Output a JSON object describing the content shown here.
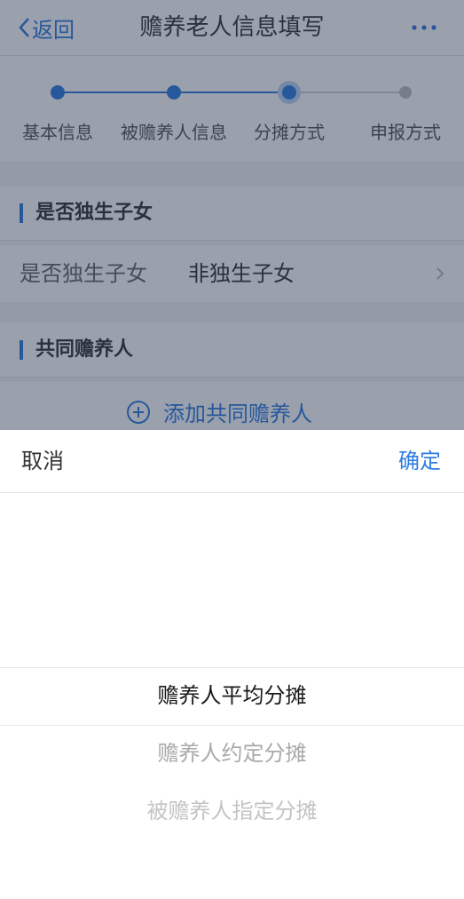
{
  "nav": {
    "back_label": "返回",
    "title": "赡养老人信息填写"
  },
  "stepper": {
    "steps": [
      {
        "label": "基本信息",
        "state": "done"
      },
      {
        "label": "被赡养人信息",
        "state": "done"
      },
      {
        "label": "分摊方式",
        "state": "current"
      },
      {
        "label": "申报方式",
        "state": "todo"
      }
    ]
  },
  "only_child_section": {
    "title": "是否独生子女",
    "field_label": "是否独生子女",
    "field_value": "非独生子女"
  },
  "co_supporter_section": {
    "title": "共同赡养人",
    "add_label": "添加共同赡养人"
  },
  "picker": {
    "cancel_label": "取消",
    "confirm_label": "确定",
    "options": [
      {
        "label": "赡养人平均分摊",
        "selected": true
      },
      {
        "label": "赡养人约定分摊",
        "selected": false
      },
      {
        "label": "被赡养人指定分摊",
        "selected": false
      }
    ]
  },
  "colors": {
    "accent": "#2f7de1",
    "overlay": "rgba(30,45,70,0.45)",
    "pending_step": "#bfbfbf"
  }
}
